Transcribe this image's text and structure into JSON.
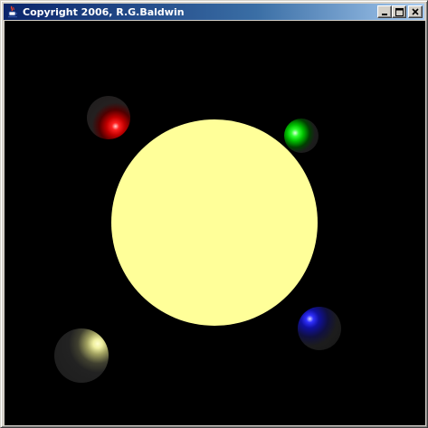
{
  "window": {
    "title": "Copyright 2006, R.G.Baldwin",
    "app_icon": "java-cup-icon",
    "buttons": {
      "minimize": "minimize-icon",
      "maximize": "maximize-icon",
      "close": "close-icon"
    }
  },
  "scene": {
    "background_color": "#000000",
    "sun": {
      "color": "#ffff99"
    },
    "planets": [
      {
        "name": "red",
        "color": "#ff2020"
      },
      {
        "name": "green",
        "color": "#30ff30"
      },
      {
        "name": "blue",
        "color": "#3030ff"
      },
      {
        "name": "yellow",
        "color": "#f0f0a0"
      }
    ]
  }
}
